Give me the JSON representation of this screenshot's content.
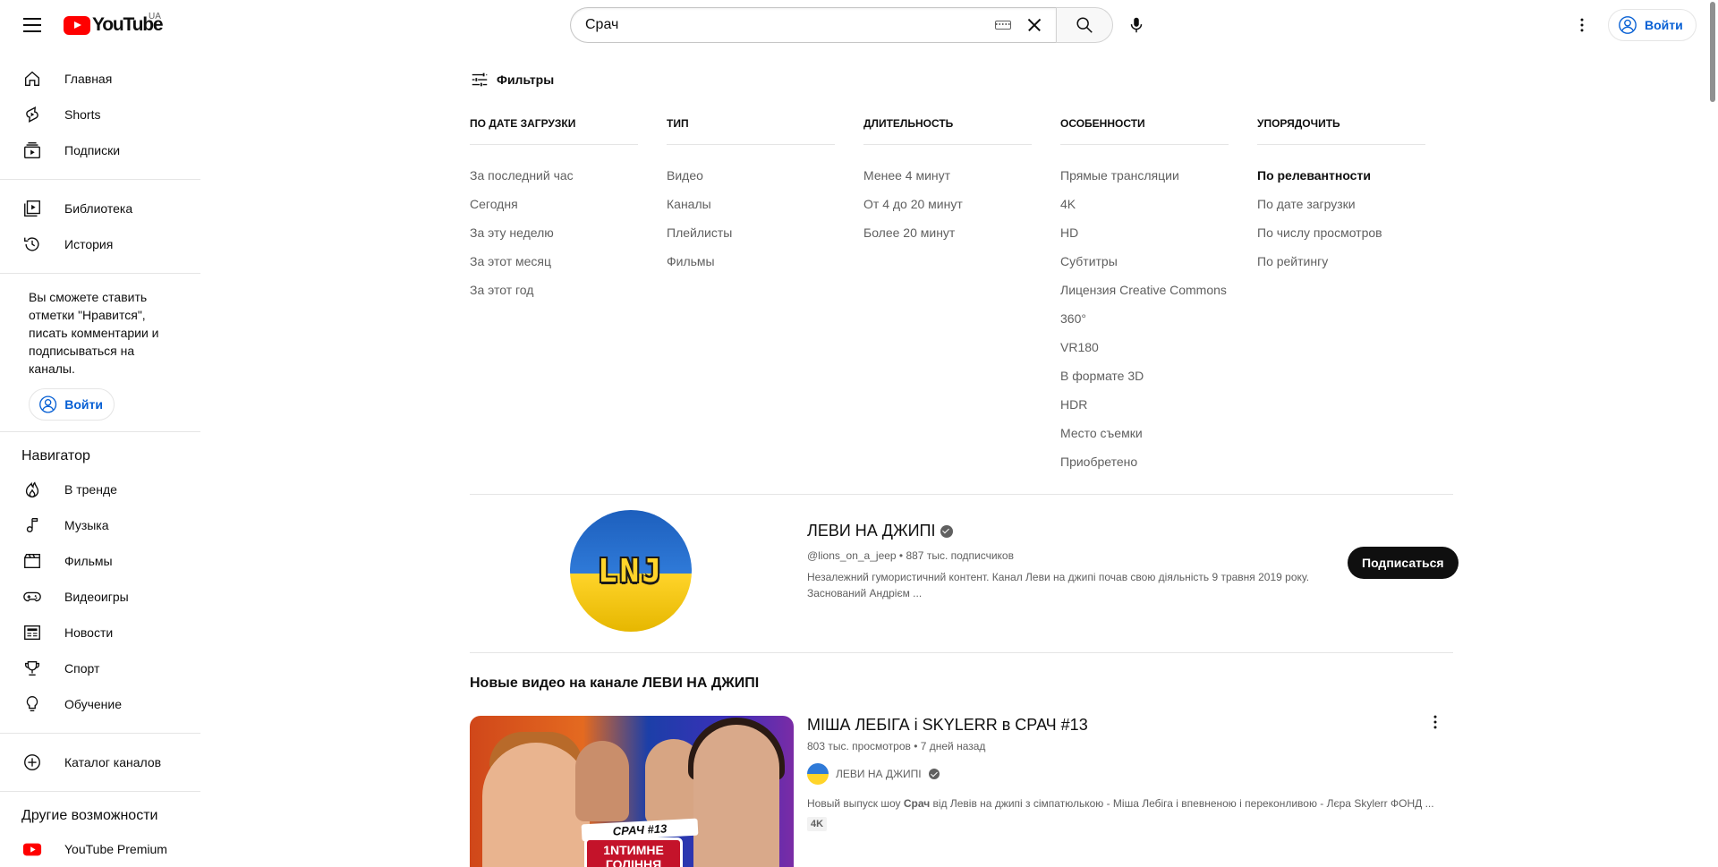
{
  "header": {
    "logo_text": "YouTube",
    "country_code": "UA",
    "search_value": "Срач",
    "signin_label": "Войти"
  },
  "sidebar": {
    "main": [
      {
        "label": "Главная",
        "icon": "home-icon"
      },
      {
        "label": "Shorts",
        "icon": "shorts-icon"
      },
      {
        "label": "Подписки",
        "icon": "subscriptions-icon"
      }
    ],
    "library": [
      {
        "label": "Библиотека",
        "icon": "library-icon"
      },
      {
        "label": "История",
        "icon": "history-icon"
      }
    ],
    "signin_note": "Вы сможете ставить отметки \"Нравится\", писать комментарии и подписываться на каналы.",
    "signin_label": "Войти",
    "navigator_title": "Навигатор",
    "navigator": [
      {
        "label": "В тренде",
        "icon": "trending-icon"
      },
      {
        "label": "Музыка",
        "icon": "music-icon"
      },
      {
        "label": "Фильмы",
        "icon": "movies-icon"
      },
      {
        "label": "Видеоигры",
        "icon": "gaming-icon"
      },
      {
        "label": "Новости",
        "icon": "news-icon"
      },
      {
        "label": "Спорт",
        "icon": "sports-icon"
      },
      {
        "label": "Обучение",
        "icon": "learning-icon"
      }
    ],
    "catalog_label": "Каталог каналов",
    "other_title": "Другие возможности",
    "premium_label": "YouTube Premium"
  },
  "filters": {
    "toggle_label": "Фильтры",
    "columns": [
      {
        "header": "По дате загрузки",
        "options": [
          "За последний час",
          "Сегодня",
          "За эту неделю",
          "За этот месяц",
          "За этот год"
        ]
      },
      {
        "header": "Тип",
        "options": [
          "Видео",
          "Каналы",
          "Плейлисты",
          "Фильмы"
        ]
      },
      {
        "header": "Длительность",
        "options": [
          "Менее 4 минут",
          "От 4 до 20 минут",
          "Более 20 минут"
        ]
      },
      {
        "header": "Особенности",
        "options": [
          "Прямые трансляции",
          "4K",
          "HD",
          "Субтитры",
          "Лицензия Creative Commons",
          "360°",
          "VR180",
          "В формате 3D",
          "HDR",
          "Место съемки",
          "Приобретено"
        ]
      },
      {
        "header": "Упорядочить",
        "options": [
          "По релевантности",
          "По дате загрузки",
          "По числу просмотров",
          "По рейтингу"
        ],
        "active_index": 0
      }
    ]
  },
  "channel": {
    "avatar_text": "LNJ",
    "name": "ЛЕВИ НА ДЖИПІ",
    "meta": "@lions_on_a_jeep • 887 тыс. подписчиков",
    "description": "Незалежний гумористичний контент. Канал Леви на джипі почав свою діяльність 9 травня 2019 року. Заснований Андрієм ...",
    "subscribe_label": "Подписаться"
  },
  "shelf": {
    "title": "Новые видео на канале ЛЕВИ НА ДЖИПІ",
    "video": {
      "thumb_badge": "СРАЧ #13",
      "thumb_caption": "1NТИМНЕ ГОЛІННЯ",
      "title": "МІША ЛЕБІГА і SKYLERR в СРАЧ #13",
      "meta": "803 тыс. просмотров • 7 дней назад",
      "channel": "ЛЕВИ НА ДЖИПІ",
      "desc_prefix": "Новый выпуск шоу ",
      "desc_bold": "Срач",
      "desc_suffix": " від Левів на джипі з сімпатюлькою - Міша Лебіга і впевненою і переконливою - Лєра Skylerr ФОНД ...",
      "quality": "4K"
    }
  },
  "colors": {
    "accent_blue": "#065fd4",
    "brand_red": "#ff0000",
    "text_primary": "#0f0f0f",
    "text_secondary": "#606060"
  }
}
